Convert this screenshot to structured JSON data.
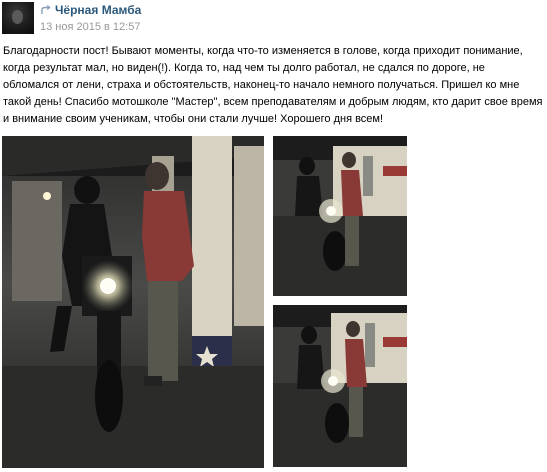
{
  "post": {
    "author": "Чёрная Мамба",
    "date": "13 ноя 2015 в 12:57",
    "text": "Благодарности пост! Бывают моменты, когда что-то изменяется в голове, когда приходит понимание, когда результат мал, но виден(!). Когда то, над чем ты долго работал, не сдался по дороге, не обломался от лени, страха и обстоятельств, наконец-то начало немного получаться. Пришел ко мне такой день! Спасибо мотошколе \"Мастер\", всем преподавателям и добрым людям, кто дарит свое время и внимание своим ученикам, чтобы они стали лучше! Хорошего дня всем!"
  },
  "icons": {
    "share": "share-arrow-icon",
    "avatar": "avatar-image"
  },
  "colors": {
    "author_link": "#2b587a",
    "date_text": "#999999",
    "body_text": "#000000"
  }
}
